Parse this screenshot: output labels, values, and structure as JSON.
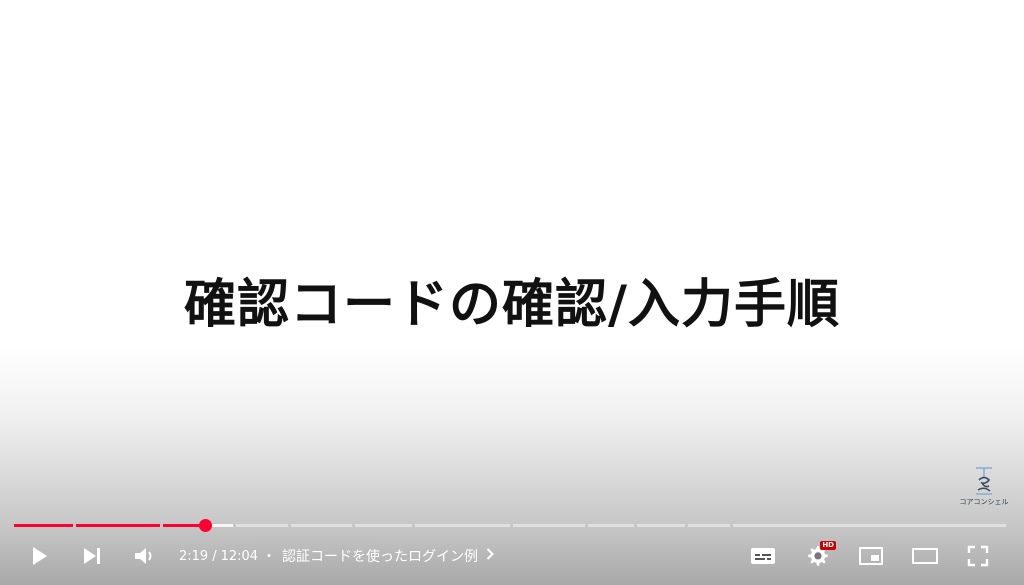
{
  "video": {
    "slide_title": "確認コードの確認/入力手順"
  },
  "watermark": {
    "text": "コアコンシェル"
  },
  "progress": {
    "played_fraction": 0.193,
    "buffered_fraction": 0.222,
    "played_color": "#ff0033",
    "chapter_breaks": [
      0.061,
      0.149,
      0.222,
      0.278,
      0.342,
      0.403,
      0.502,
      0.577,
      0.627,
      0.678,
      0.723,
      1.0
    ]
  },
  "controls": {
    "current_time": "2:19",
    "separator": "/",
    "duration": "12:04",
    "chapter_dot": "・",
    "chapter_title": "認証コードを使ったログイン例",
    "hd_badge": "HD"
  }
}
